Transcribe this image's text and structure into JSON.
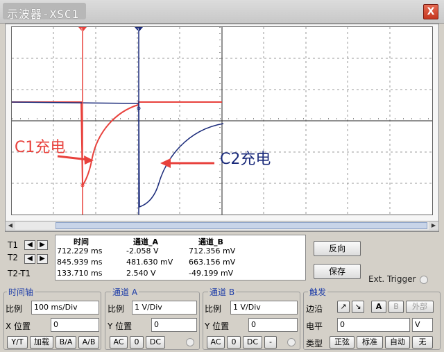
{
  "window": {
    "title": "示波器-XSC1",
    "close_label": "X"
  },
  "annotations": {
    "c1_text": "C1充电",
    "c2_text": "C2充电"
  },
  "cursors": {
    "t1_label": "1",
    "t2_label": "2"
  },
  "readout": {
    "headers": {
      "time": "时间",
      "channel_a": "通道_A",
      "channel_b": "通道_B"
    },
    "rows": [
      {
        "label": "T1",
        "time": "712.229 ms",
        "a": "-2.058 V",
        "b": "712.356 mV"
      },
      {
        "label": "T2",
        "time": "845.939 ms",
        "a": "481.630 mV",
        "b": "663.156 mV"
      },
      {
        "label": "T2-T1",
        "time": "133.710 ms",
        "a": "2.540 V",
        "b": "-49.199 mV"
      }
    ]
  },
  "buttons": {
    "reverse": "反向",
    "save": "保存",
    "ext_trigger": "Ext. Trigger"
  },
  "timebase": {
    "title": "时间轴",
    "scale_label": "比例",
    "scale_value": "100 ms/Div",
    "xpos_label": "X 位置",
    "xpos_value": "0",
    "modes": [
      "Y/T",
      "加载",
      "B/A",
      "A/B"
    ]
  },
  "channel_a": {
    "title": "通道 A",
    "scale_label": "比例",
    "scale_value": "1  V/Div",
    "ypos_label": "Y 位置",
    "ypos_value": "0",
    "coupling": [
      "AC",
      "0",
      "DC"
    ]
  },
  "channel_b": {
    "title": "通道 B",
    "scale_label": "比例",
    "scale_value": "1  V/Div",
    "ypos_label": "Y 位置",
    "ypos_value": "0",
    "coupling": [
      "AC",
      "0",
      "DC",
      "-"
    ]
  },
  "trigger": {
    "title": "触发",
    "edge_label": "边沿",
    "edge_buttons": [
      "A",
      "B",
      "外部"
    ],
    "level_label": "电平",
    "level_value": "0",
    "level_unit": "V",
    "type_label": "类型",
    "types": [
      "正弦",
      "标准",
      "自动",
      "无"
    ]
  },
  "colors": {
    "channel_a": "#e8413c",
    "channel_b": "#1a2a7a",
    "title_text": "#1f3ea8"
  }
}
